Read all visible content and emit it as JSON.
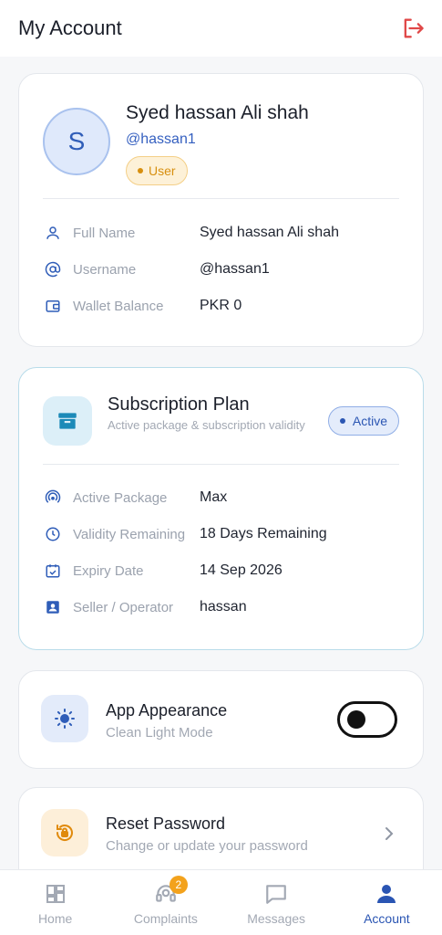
{
  "header": {
    "title": "My Account",
    "logout_icon": "logout-icon"
  },
  "profile": {
    "avatar_initial": "S",
    "name": "Syed hassan Ali shah",
    "username": "@hassan1",
    "role": "User",
    "rows": [
      {
        "icon": "person-icon",
        "label": "Full Name",
        "value": "Syed hassan Ali shah"
      },
      {
        "icon": "at-sign-icon",
        "label": "Username",
        "value": "@hassan1"
      },
      {
        "icon": "wallet-icon",
        "label": "Wallet Balance",
        "value": "PKR 0"
      }
    ]
  },
  "subscription": {
    "title": "Subscription Plan",
    "subtitle": "Active package & subscription validity",
    "status": "Active",
    "rows": [
      {
        "icon": "signal-icon",
        "label": "Active Package",
        "value": "Max"
      },
      {
        "icon": "clock-icon",
        "label": "Validity Remaining",
        "value": "18 Days Remaining"
      },
      {
        "icon": "calendar-check-icon",
        "label": "Expiry Date",
        "value": "14 Sep 2026"
      },
      {
        "icon": "contact-badge-icon",
        "label": "Seller / Operator",
        "value": "hassan"
      }
    ]
  },
  "appearance": {
    "title": "App Appearance",
    "subtitle": "Clean Light Mode",
    "dark_mode": false
  },
  "reset_password": {
    "title": "Reset Password",
    "subtitle": "Change or update your password"
  },
  "nav": {
    "items": [
      {
        "label": "Home",
        "icon": "dashboard-icon",
        "active": false
      },
      {
        "label": "Complaints",
        "icon": "support-agent-icon",
        "badge": "2",
        "active": false
      },
      {
        "label": "Messages",
        "icon": "chat-bubble-icon",
        "active": false
      },
      {
        "label": "Account",
        "icon": "person-icon",
        "active": true
      }
    ]
  },
  "colors": {
    "accent": "#2a55b3",
    "danger": "#e04848",
    "warning": "#f3a21c",
    "cyan": "#1c8ab8"
  }
}
